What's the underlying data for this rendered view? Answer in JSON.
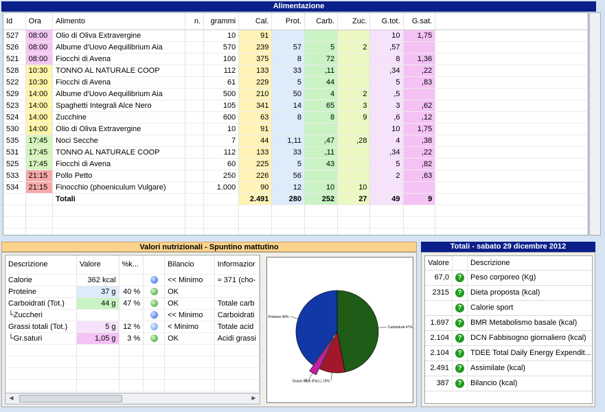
{
  "alimentazione": {
    "title": "Alimentazione",
    "headers": {
      "id": "Id",
      "ora": "Ora",
      "alimento": "Alimento",
      "n": "n.",
      "grammi": "grammi",
      "cal": "Cal.",
      "prot": "Prot.",
      "carb": "Carb.",
      "zuc": "Zuc.",
      "gtot": "G.tot.",
      "gsat": "G.sat."
    },
    "rows": [
      {
        "id": "527",
        "ora": "08:00",
        "ora_color": "pink",
        "alimento": "Olio di Oliva Extravergine",
        "n": "",
        "grammi": "10",
        "cal": "91",
        "prot": "",
        "carb": "",
        "zuc": "",
        "gtot": "10",
        "gsat": "1,75"
      },
      {
        "id": "526",
        "ora": "08:00",
        "ora_color": "pink",
        "alimento": "Albume d'Uovo Aequilibrium Aia",
        "n": "",
        "grammi": "570",
        "cal": "239",
        "prot": "57",
        "carb": "5",
        "zuc": "2",
        "gtot": ",57",
        "gsat": ""
      },
      {
        "id": "521",
        "ora": "08:00",
        "ora_color": "pink",
        "alimento": "Fiocchi di Avena",
        "n": "",
        "grammi": "100",
        "cal": "375",
        "prot": "8",
        "carb": "72",
        "zuc": "",
        "gtot": "8",
        "gsat": "1,36"
      },
      {
        "id": "528",
        "ora": "10:30",
        "ora_color": "yellow",
        "alimento": "TONNO AL NATURALE COOP",
        "n": "",
        "grammi": "112",
        "cal": "133",
        "prot": "33",
        "carb": ",11",
        "zuc": "",
        "gtot": ",34",
        "gsat": ",22"
      },
      {
        "id": "522",
        "ora": "10:30",
        "ora_color": "yellow",
        "alimento": "Fiocchi di Avena",
        "n": "",
        "grammi": "61",
        "cal": "229",
        "prot": "5",
        "carb": "44",
        "zuc": "",
        "gtot": "5",
        "gsat": ",83"
      },
      {
        "id": "529",
        "ora": "14:00",
        "ora_color": "yellow",
        "alimento": "Albume d'Uovo Aequilibrium Aia",
        "n": "",
        "grammi": "500",
        "cal": "210",
        "prot": "50",
        "carb": "4",
        "zuc": "2",
        "gtot": ",5",
        "gsat": ""
      },
      {
        "id": "523",
        "ora": "14:00",
        "ora_color": "yellow",
        "alimento": "Spaghetti Integrali Alce Nero",
        "n": "",
        "grammi": "105",
        "cal": "341",
        "prot": "14",
        "carb": "65",
        "zuc": "3",
        "gtot": "3",
        "gsat": ",62"
      },
      {
        "id": "524",
        "ora": "14:00",
        "ora_color": "yellow",
        "alimento": "Zucchine",
        "n": "",
        "grammi": "600",
        "cal": "63",
        "prot": "8",
        "carb": "8",
        "zuc": "9",
        "gtot": ",6",
        "gsat": ",12"
      },
      {
        "id": "530",
        "ora": "14:00",
        "ora_color": "yellow",
        "alimento": "Olio di Oliva Extravergine",
        "n": "",
        "grammi": "10",
        "cal": "91",
        "prot": "",
        "carb": "",
        "zuc": "",
        "gtot": "10",
        "gsat": "1,75"
      },
      {
        "id": "535",
        "ora": "17:45",
        "ora_color": "green",
        "alimento": "Noci Secche",
        "n": "",
        "grammi": "7",
        "cal": "44",
        "prot": "1,11",
        "carb": ",47",
        "zuc": ",28",
        "gtot": "4",
        "gsat": ",38"
      },
      {
        "id": "531",
        "ora": "17:45",
        "ora_color": "green",
        "alimento": "TONNO AL NATURALE COOP",
        "n": "",
        "grammi": "112",
        "cal": "133",
        "prot": "33",
        "carb": ",11",
        "zuc": "",
        "gtot": ",34",
        "gsat": ",22"
      },
      {
        "id": "525",
        "ora": "17:45",
        "ora_color": "green",
        "alimento": "Fiocchi di Avena",
        "n": "",
        "grammi": "60",
        "cal": "225",
        "prot": "5",
        "carb": "43",
        "zuc": "",
        "gtot": "5",
        "gsat": ",82"
      },
      {
        "id": "533",
        "ora": "21:15",
        "ora_color": "red",
        "alimento": "Pollo Petto",
        "n": "",
        "grammi": "250",
        "cal": "226",
        "prot": "56",
        "carb": "",
        "zuc": "",
        "gtot": "2",
        "gsat": ",63"
      },
      {
        "id": "534",
        "ora": "21:15",
        "ora_color": "red",
        "alimento": "Finocchio (phoeniculum Vulgare)",
        "n": "",
        "grammi": "1.000",
        "cal": "90",
        "prot": "12",
        "carb": "10",
        "zuc": "10",
        "gtot": "",
        "gsat": ""
      }
    ],
    "totals": {
      "label": "Totali",
      "cal": "2.491",
      "prot": "280",
      "carb": "252",
      "zuc": "27",
      "gtot": "49",
      "gsat": "9"
    }
  },
  "valori": {
    "title": "Valori nutrizionali - Spuntino mattutino",
    "headers": {
      "descrizione": "Descrizione",
      "valore": "Valore",
      "perc": "%k...",
      "bilancio": "Bilancio",
      "info": "Informazior"
    },
    "rows": [
      {
        "descrizione": "Calorie",
        "valore": "362 kcal",
        "valore_color": "none",
        "perc": "",
        "ball": "blue",
        "bilancio": "<< Minimo",
        "info": "≈ 371 (cho-"
      },
      {
        "descrizione": "Proteine",
        "valore": "37 g",
        "valore_color": "blue",
        "perc": "40 %",
        "ball": "green",
        "bilancio": "OK",
        "info": ""
      },
      {
        "descrizione": "Carboidrati (Tot.)",
        "valore": "44 g",
        "valore_color": "green",
        "perc": "47 %",
        "ball": "green",
        "bilancio": "OK",
        "info": "Totale carb"
      },
      {
        "descrizione": "└Zuccheri",
        "valore": "",
        "valore_color": "none",
        "perc": "",
        "ball": "blue",
        "bilancio": "<< Minimo",
        "info": "Carboidrati"
      },
      {
        "descrizione": "Grassi totali (Tot.)",
        "valore": "5 g",
        "valore_color": "lpink",
        "perc": "12 %",
        "ball": "lblue",
        "bilancio": "< Minimo",
        "info": "Totale acid"
      },
      {
        "descrizione": " └Gr.saturi",
        "valore": "1,05 g",
        "valore_color": "pink",
        "perc": "3 %",
        "ball": "green",
        "bilancio": "OK",
        "info": "Acidi grassi"
      }
    ]
  },
  "chart_data": {
    "type": "pie",
    "slices": [
      {
        "label": "Carboidrati 47%",
        "value": 47,
        "color": "#1e5c17"
      },
      {
        "label": "Grassi totali (Parz.) 10%",
        "value": 10,
        "color": "#a3172c"
      },
      {
        "label": "G",
        "value": 3,
        "color": "#c41fa6"
      },
      {
        "label": "Proteine 40%",
        "value": 40,
        "color": "#1238a8"
      }
    ]
  },
  "totali": {
    "title": "Totali - sabato 29 dicembre 2012",
    "headers": {
      "valore": "Valore",
      "descrizione": "Descrizione"
    },
    "rows": [
      {
        "valore": "67,0",
        "descrizione": "Peso corporeo (Kg)"
      },
      {
        "valore": "2315",
        "descrizione": "Dieta proposta (kcal)"
      },
      {
        "valore": "",
        "descrizione": "Calorie sport"
      },
      {
        "valore": "1.697",
        "descrizione": "BMR Metabolismo basale (kcal)"
      },
      {
        "valore": "2.104",
        "descrizione": "DCN Fabbisogno giornaliero (kcal)"
      },
      {
        "valore": "2.104",
        "descrizione": "TDEE Total Daily Energy Expendit..."
      },
      {
        "valore": "2.491",
        "descrizione": "Assimilate (kcal)"
      },
      {
        "valore": "387",
        "descrizione": "Bilancio (kcal)"
      }
    ],
    "help_glyph": "?"
  }
}
